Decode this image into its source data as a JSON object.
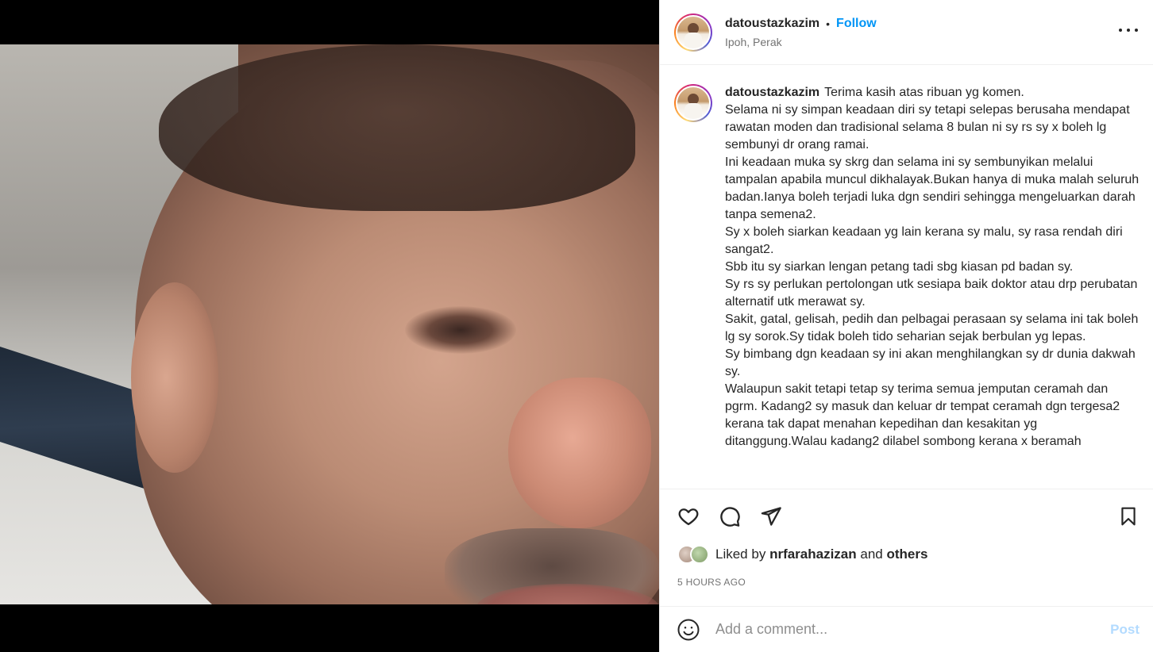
{
  "post": {
    "username": "datoustazkazim",
    "separator": "•",
    "follow_label": "Follow",
    "location": "Ipoh, Perak"
  },
  "caption": {
    "username": "datoustazkazim",
    "lines": [
      "Terima kasih atas ribuan yg komen.",
      "Selama ni sy simpan keadaan diri sy tetapi selepas berusaha mendapat rawatan moden dan tradisional selama 8 bulan ni sy rs sy x boleh lg sembunyi dr orang ramai.",
      "Ini keadaan muka sy skrg dan selama ini sy sembunyikan melalui tampalan apabila muncul dikhalayak.Bukan hanya di muka malah seluruh badan.Ianya boleh terjadi luka dgn sendiri sehingga mengeluarkan darah tanpa semena2.",
      "Sy x boleh siarkan keadaan yg lain kerana sy malu, sy rasa rendah diri sangat2.",
      "Sbb itu sy siarkan lengan petang tadi sbg kiasan pd badan sy.",
      "Sy rs sy perlukan pertolongan utk sesiapa baik doktor atau drp perubatan alternatif utk merawat sy.",
      "Sakit, gatal, gelisah, pedih dan pelbagai perasaan sy selama ini tak boleh lg sy sorok.Sy tidak boleh tido seharian sejak berbulan yg lepas.",
      "Sy bimbang dgn keadaan sy ini akan menghilangkan sy dr dunia dakwah sy.",
      "Walaupun sakit tetapi tetap sy terima semua jemputan ceramah dan pgrm. Kadang2 sy masuk dan keluar dr tempat ceramah dgn tergesa2 kerana tak dapat menahan kepedihan dan kesakitan yg ditanggung.Walau kadang2 dilabel sombong kerana x beramah"
    ]
  },
  "likes": {
    "prefix": "Liked by",
    "user": "nrfarahazizan",
    "and": "and",
    "others": "others"
  },
  "timestamp": "5 HOURS AGO",
  "comment": {
    "placeholder": "Add a comment...",
    "post_label": "Post"
  },
  "icons": {
    "more": "more-options-icon",
    "like": "heart-icon",
    "comment": "comment-icon",
    "share": "share-icon",
    "save": "bookmark-icon",
    "emoji": "emoji-icon"
  },
  "colors": {
    "accent": "#0095f6",
    "post_disabled": "#b3dbff",
    "muted": "#737373"
  }
}
